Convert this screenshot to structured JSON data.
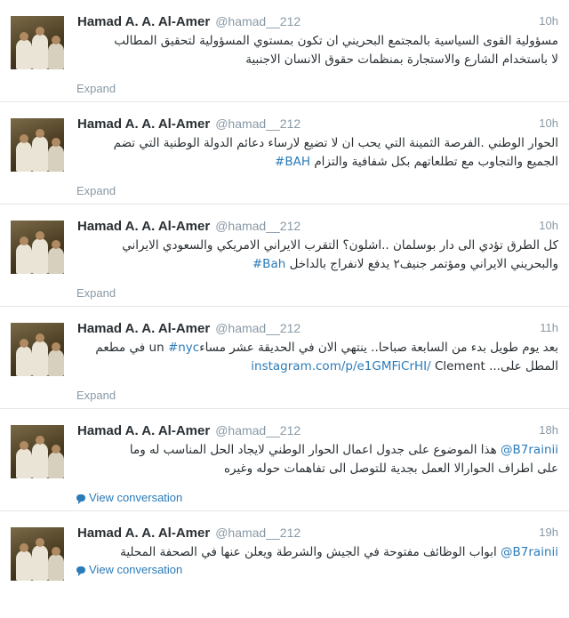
{
  "tweets": [
    {
      "name": "Hamad A. A. Al-Amer",
      "handle": "@hamad__212",
      "time": "10h",
      "line1": "مسؤولية القوى السياسية بالمجتمع البحريني ان تكون بمستوي المسؤولية لتحقيق المطالب",
      "line2": "لا باستخدام الشارع والاستجارة بمنظمات حقوق الانسان الاجنبية",
      "action": "Expand"
    },
    {
      "name": "Hamad A. A. Al-Amer",
      "handle": "@hamad__212",
      "time": "10h",
      "line1": "الحوار الوطني .الفرصة الثمينة التي يحب ان لا تضيع لارساء دعائم الدولة الوطنية التي تضم",
      "line2_text": "الجميع والتجاوب مع تطلعاتهم بكل شفافية والتزام",
      "line2_tag": "#BAH",
      "action": "Expand"
    },
    {
      "name": "Hamad A. A. Al-Amer",
      "handle": "@hamad__212",
      "time": "10h",
      "line1": "كل الطرق تؤدي الى دار بوسلمان ..اشلون؟ التقرب الايراني الامريكي والسعودي الايراني",
      "line2_text": "والبحريني الايراني ومؤتمر جنيف٢ يدفع لانفراج بالداخل",
      "line2_tag": "#Bah",
      "action": "Expand"
    },
    {
      "name": "Hamad A. A. Al-Amer",
      "handle": "@hamad__212",
      "time": "11h",
      "line1_text": "بعد يوم طويل بدء من السابعة صباحا.. ينتهي الان في الحديقة عشر مساء",
      "line1_tag": "#nyc",
      "line1_end": "un في مطعم",
      "line2_link": "instagram.com/p/e1GMFiCrHI/",
      "line2_text": "المطل على... Clement",
      "action": "Expand"
    },
    {
      "name": "Hamad A. A. Al-Amer",
      "handle": "@hamad__212",
      "time": "18h",
      "line1_mention": "@B7rainii",
      "line1_text": "هذا الموضوع على جدول اعمال الحوار الوطني لايجاد الحل المناسب له وما",
      "line2": "على اطراف الحوارالا العمل بجدية للتوصل الى تفاهمات حوله وغيره",
      "action": "View conversation"
    },
    {
      "name": "Hamad A. A. Al-Amer",
      "handle": "@hamad__212",
      "time": "19h",
      "line1_mention": "@B7rainii",
      "line1_text": "ابواب الوظائف مفتوحة في الجيش والشرطة ويعلن عنها في الصحفة المحلية",
      "action": "View conversation"
    }
  ],
  "colors": {
    "link": "#2b7bb9",
    "muted": "#8899a6",
    "name": "#292f33"
  }
}
